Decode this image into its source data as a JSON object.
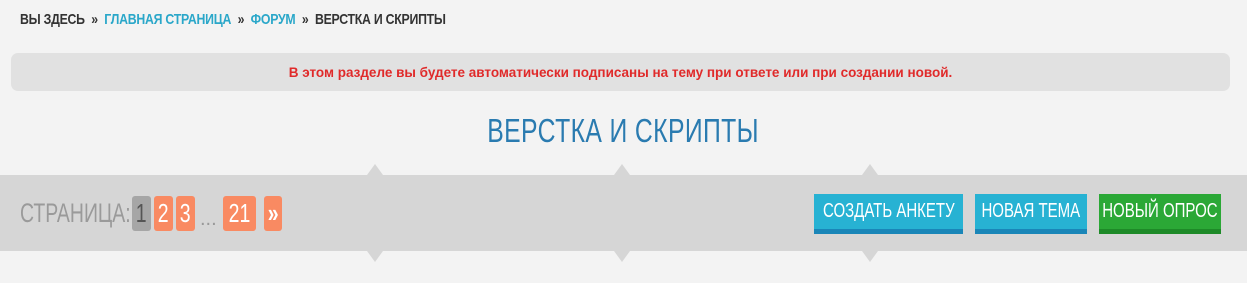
{
  "breadcrumb": {
    "prefix": "ВЫ ЗДЕСЬ",
    "separator": "»",
    "links": [
      "ГЛАВНАЯ СТРАНИЦА",
      "ФОРУМ"
    ],
    "current": "ВЕРСТКА И СКРИПТЫ"
  },
  "notice": {
    "text": "В этом разделе вы будете автоматически подписаны на тему при ответе или при создании новой."
  },
  "forum": {
    "title": "ВЕРСТКА И СКРИПТЫ"
  },
  "pagination": {
    "label": "СТРАНИЦА:",
    "current": "1",
    "pages": [
      "2",
      "3"
    ],
    "ellipsis": "...",
    "last": "21",
    "next": "»"
  },
  "actions": {
    "create_form": "СОЗДАТЬ АНКЕТУ",
    "new_topic": "НОВАЯ ТЕМА",
    "new_poll": "НОВЫЙ ОПРОС"
  },
  "colors": {
    "link": "#2aa7c9",
    "notice_text": "#e02a2a",
    "title": "#2a7bb0",
    "page_button": "#f98a62",
    "action_blue": "#27b2d3",
    "action_green": "#2ba836"
  }
}
